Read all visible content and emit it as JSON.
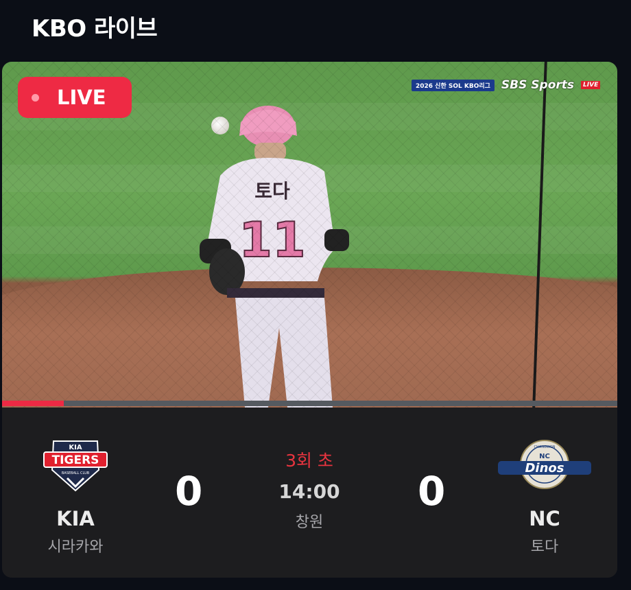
{
  "header": {
    "title": "KBO 라이브"
  },
  "video": {
    "live_label": "LIVE",
    "broadcast": {
      "league": "2026 신한 SOL KBO리그",
      "network": "SBS Sports",
      "network_live": "LIVE"
    },
    "player": {
      "name": "토다",
      "number": "11"
    },
    "progress": 0.1
  },
  "game": {
    "inning": "3회 초",
    "time": "14:00",
    "venue": "창원",
    "home": {
      "name": "KIA",
      "pitcher": "시라카와",
      "score": "0",
      "logo": {
        "word": "TIGERS",
        "brand": "KIA",
        "sub": "BASEBALL CLUB"
      }
    },
    "away": {
      "name": "NC",
      "pitcher": "토다",
      "score": "0",
      "logo": {
        "word": "Dinos",
        "brand": "NC",
        "ring": "CHANGWON"
      }
    }
  },
  "colors": {
    "accent": "#ee2a44",
    "inning": "#e8343f",
    "panel": "#1d1d1f",
    "background": "#0b0e16"
  }
}
